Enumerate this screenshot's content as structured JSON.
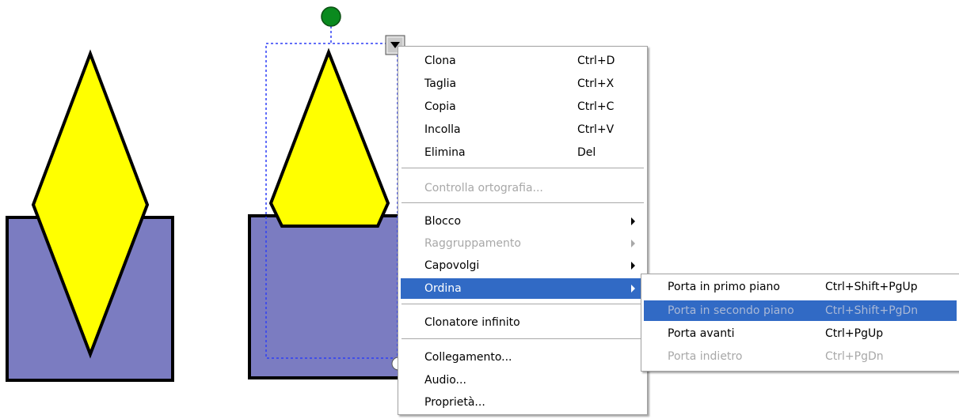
{
  "colors": {
    "rectangle_fill": "#7b7cc1",
    "diamond_fill": "#ffff00",
    "outline": "#000000",
    "selection": "#2e3ff5",
    "rotate_handle": "#0a8a1e",
    "menu_highlight": "#316ac5"
  },
  "context_menu": {
    "items": [
      {
        "label": "Clona",
        "shortcut": "Ctrl+D"
      },
      {
        "label": "Taglia",
        "shortcut": "Ctrl+X"
      },
      {
        "label": "Copia",
        "shortcut": "Ctrl+C"
      },
      {
        "label": "Incolla",
        "shortcut": "Ctrl+V"
      },
      {
        "label": "Elimina",
        "shortcut": "Del"
      },
      {
        "label": "Controlla ortografia..."
      },
      {
        "label": "Blocco"
      },
      {
        "label": "Raggruppamento"
      },
      {
        "label": "Capovolgi"
      },
      {
        "label": "Ordina"
      },
      {
        "label": "Clonatore infinito"
      },
      {
        "label": "Collegamento..."
      },
      {
        "label": "Audio..."
      },
      {
        "label": "Proprietà..."
      }
    ]
  },
  "order_submenu": {
    "items": [
      {
        "label": "Porta in primo piano",
        "shortcut": "Ctrl+Shift+PgUp"
      },
      {
        "label": "Porta in secondo piano",
        "shortcut": "Ctrl+Shift+PgDn"
      },
      {
        "label": "Porta avanti",
        "shortcut": "Ctrl+PgUp"
      },
      {
        "label": "Porta indietro",
        "shortcut": "Ctrl+PgDn"
      }
    ]
  }
}
